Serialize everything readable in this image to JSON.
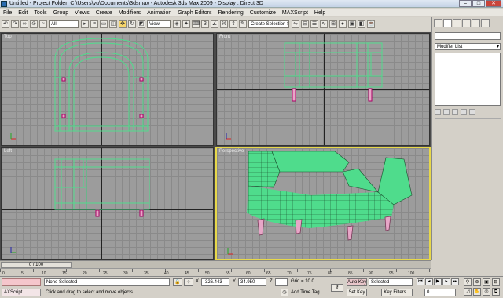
{
  "window": {
    "title": "Untitled    - Project Folder: C:\\Users\\yu\\Documents\\3dsmax    - Autodesk 3ds Max  2009       - Display : Direct 3D",
    "buttons": {
      "minimize": "–",
      "maximize": "□",
      "close": "✕"
    }
  },
  "menubar": {
    "items": [
      "File",
      "Edit",
      "Tools",
      "Group",
      "Views",
      "Create",
      "Modifiers",
      "Animation",
      "Graph Editors",
      "Rendering",
      "Customize",
      "MAXScript",
      "Help"
    ]
  },
  "toolbar": {
    "filter": "All",
    "view": "View",
    "selection_set": "Create Selection Set"
  },
  "viewports": {
    "top": "Top",
    "front": "Front",
    "left": "Left",
    "perspective": "Perspective"
  },
  "command_panel": {
    "modifier_list": "Modifier List"
  },
  "timeline": {
    "slider": "0 / 100",
    "ticks": [
      "0",
      "5",
      "10",
      "15",
      "20",
      "25",
      "30",
      "35",
      "40",
      "45",
      "50",
      "55",
      "60",
      "65",
      "70",
      "75",
      "80",
      "85",
      "90",
      "95",
      "100"
    ]
  },
  "status": {
    "maxscript": "AXScript.",
    "selection": "None Selected",
    "prompt": "Click and drag to select and move objects",
    "x_label": "X",
    "x_value": "-326.443",
    "y_label": "Y",
    "y_value": "34.950",
    "z_label": "Z",
    "z_value": "",
    "grid": "Grid = 10.0",
    "add_time_tag": "Add Time Tag",
    "auto_key": "Auto Key",
    "set_key": "Set Key",
    "key_mode": "Selected",
    "key_filters": "Key Filters...",
    "frame": "0"
  },
  "colors": {
    "viewport_bg": "#9c9c9c",
    "object": "#4fdc8c",
    "legs": "#e7a6c7",
    "active_border": "#e7d84a"
  }
}
